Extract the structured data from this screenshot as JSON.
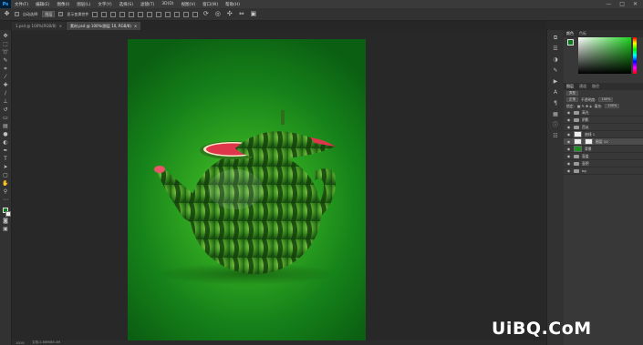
{
  "menubar": {
    "app_icon": "Ps",
    "items": [
      "文件(F)",
      "编辑(E)",
      "图像(I)",
      "图层(L)",
      "文字(Y)",
      "选择(S)",
      "滤镜(T)",
      "3D(D)",
      "视图(V)",
      "窗口(W)",
      "帮助(H)"
    ],
    "window_buttons": [
      "—",
      "□",
      "✕"
    ]
  },
  "optionsbar": {
    "auto_select_label": "自动选择:",
    "auto_select_value": "图层",
    "show_transform_label": "显示变换控件"
  },
  "tabs": [
    {
      "label": "1.psd @ 100%(RGB/8)",
      "close": "×"
    },
    {
      "label": "素材.psd @ 100%(图层 10, RGB/8)",
      "close": "×"
    }
  ],
  "statusbar": {
    "zoom": "100%",
    "doc_info": "文档:2.86M/86.4M"
  },
  "panels": {
    "color_tabs": [
      "颜色",
      "色板"
    ],
    "layers_tabs": [
      "图层",
      "通道",
      "路径"
    ],
    "kind_label": "类型",
    "blend_mode": "正常",
    "opacity_label": "不透明度:",
    "opacity_value": "100%",
    "lock_label": "锁定:",
    "fill_label": "填充:",
    "fill_value": "100%"
  },
  "layers": [
    {
      "name": "高光",
      "type": "folder",
      "selected": false
    },
    {
      "name": "阴影",
      "type": "folder",
      "selected": false
    },
    {
      "name": "西瓜",
      "type": "folder",
      "selected": false
    },
    {
      "name": "曲线 1",
      "type": "adjustment",
      "selected": false
    },
    {
      "name": "图层 10",
      "type": "layer",
      "selected": true
    },
    {
      "name": "背景",
      "type": "layer",
      "selected": false
    },
    {
      "name": "壶盖",
      "type": "folder",
      "selected": false
    },
    {
      "name": "壶把",
      "type": "folder",
      "selected": false
    },
    {
      "name": "bg",
      "type": "folder",
      "selected": false
    }
  ],
  "watermark": "UiBQ.CoM",
  "colors": {
    "foreground": "#0a7d1a",
    "background": "#f2f2f2",
    "canvas_gradient_center": "#5fcc3a",
    "canvas_gradient_edge": "#0b5f12"
  },
  "icons": {
    "tools": [
      "move-icon",
      "marquee-icon",
      "lasso-icon",
      "quick-select-icon",
      "crop-icon",
      "eyedropper-icon",
      "healing-icon",
      "brush-icon",
      "stamp-icon",
      "history-brush-icon",
      "eraser-icon",
      "gradient-icon",
      "blur-icon",
      "dodge-icon",
      "pen-icon",
      "type-icon",
      "path-select-icon",
      "shape-icon",
      "hand-icon",
      "zoom-icon"
    ]
  }
}
